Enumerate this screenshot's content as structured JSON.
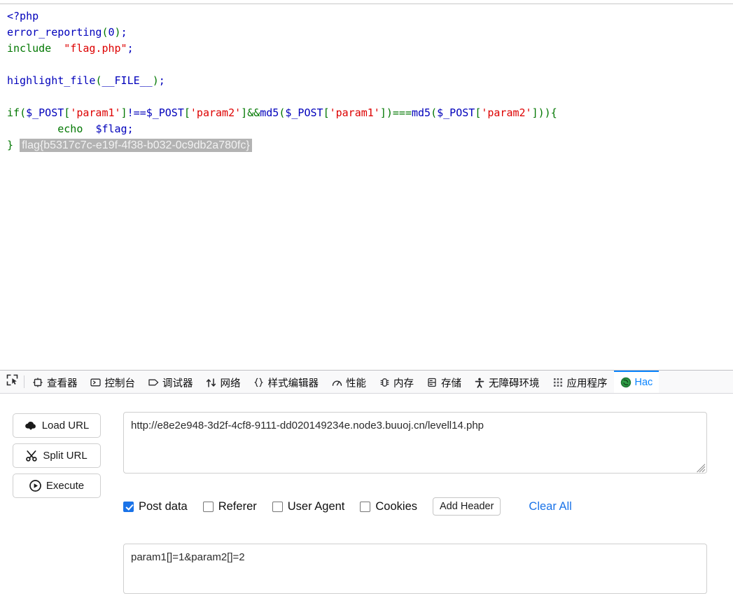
{
  "page": {
    "code_lines": [
      "<?php",
      "error_reporting(0);",
      "include  \"flag.php\";",
      "",
      "highlight_file(__FILE__);",
      "",
      "if($_POST['param1']!==$_POST['param2']&&md5($_POST['param1'])===md5($_POST['param2'])){",
      "        echo  $flag;",
      "}"
    ],
    "flag_text": "flag{b5317c7c-e19f-4f38-b032-0c9db2a780fc}"
  },
  "devtools": {
    "picker_icon": "element-picker-icon",
    "tabs": [
      {
        "label": "查看器",
        "icon": "inspector-icon",
        "active": false
      },
      {
        "label": "控制台",
        "icon": "console-icon",
        "active": false
      },
      {
        "label": "调试器",
        "icon": "debugger-icon",
        "active": false
      },
      {
        "label": "网络",
        "icon": "network-icon",
        "active": false
      },
      {
        "label": "样式编辑器",
        "icon": "style-editor-icon",
        "active": false
      },
      {
        "label": "性能",
        "icon": "performance-icon",
        "active": false
      },
      {
        "label": "内存",
        "icon": "memory-icon",
        "active": false
      },
      {
        "label": "存储",
        "icon": "storage-icon",
        "active": false
      },
      {
        "label": "无障碍环境",
        "icon": "accessibility-icon",
        "active": false
      },
      {
        "label": "应用程序",
        "icon": "application-icon",
        "active": false
      },
      {
        "label": "Hac",
        "icon": "hackbar-icon",
        "active": true
      }
    ],
    "accent_color": "#0a84ff"
  },
  "hackbar": {
    "buttons": [
      {
        "label": "Load URL",
        "icon": "cloud-download-icon"
      },
      {
        "label": "Split URL",
        "icon": "scissors-icon"
      },
      {
        "label": "Execute",
        "icon": "play-icon"
      }
    ],
    "url_value": "http://e8e2e948-3d2f-4cf8-9111-dd020149234e.node3.buuoj.cn/levell14.php",
    "url_placeholder": "",
    "options": [
      {
        "label": "Post data",
        "checked": true
      },
      {
        "label": "Referer",
        "checked": false
      },
      {
        "label": "User Agent",
        "checked": false
      },
      {
        "label": "Cookies",
        "checked": false
      }
    ],
    "add_header_label": "Add Header",
    "clear_all_label": "Clear All",
    "post_data_value": "param1[]=1&param2[]=2",
    "post_data_placeholder": ""
  }
}
